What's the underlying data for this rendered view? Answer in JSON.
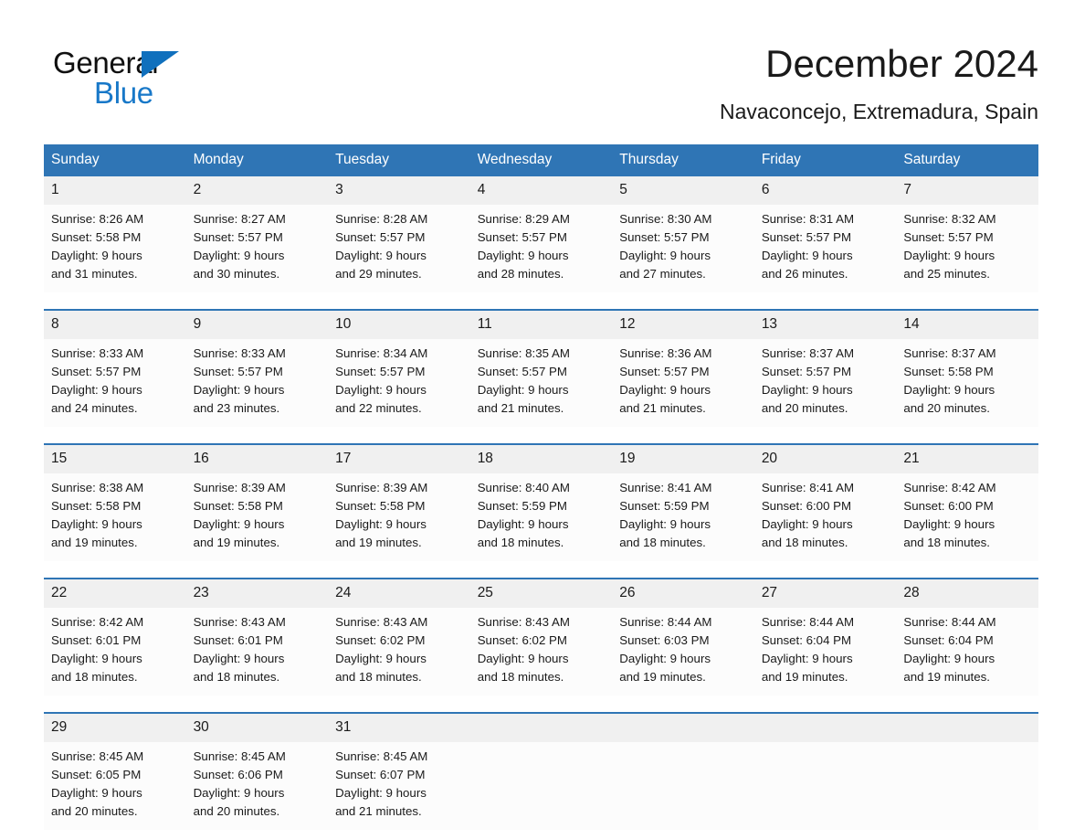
{
  "brand": {
    "name_part1": "General",
    "name_part2": "Blue"
  },
  "header": {
    "title": "December 2024",
    "subtitle": "Navaconcejo, Extremadura, Spain"
  },
  "colors": {
    "header_blue": "#2f75b5",
    "logo_blue": "#1878c8",
    "daynum_band": "#f0f0f0",
    "cell_bg": "#fcfcfc"
  },
  "calendar": {
    "weekday_headers": [
      "Sunday",
      "Monday",
      "Tuesday",
      "Wednesday",
      "Thursday",
      "Friday",
      "Saturday"
    ],
    "weeks": [
      [
        {
          "day": "1",
          "sunrise": "Sunrise: 8:26 AM",
          "sunset": "Sunset: 5:58 PM",
          "daylight1": "Daylight: 9 hours",
          "daylight2": "and 31 minutes."
        },
        {
          "day": "2",
          "sunrise": "Sunrise: 8:27 AM",
          "sunset": "Sunset: 5:57 PM",
          "daylight1": "Daylight: 9 hours",
          "daylight2": "and 30 minutes."
        },
        {
          "day": "3",
          "sunrise": "Sunrise: 8:28 AM",
          "sunset": "Sunset: 5:57 PM",
          "daylight1": "Daylight: 9 hours",
          "daylight2": "and 29 minutes."
        },
        {
          "day": "4",
          "sunrise": "Sunrise: 8:29 AM",
          "sunset": "Sunset: 5:57 PM",
          "daylight1": "Daylight: 9 hours",
          "daylight2": "and 28 minutes."
        },
        {
          "day": "5",
          "sunrise": "Sunrise: 8:30 AM",
          "sunset": "Sunset: 5:57 PM",
          "daylight1": "Daylight: 9 hours",
          "daylight2": "and 27 minutes."
        },
        {
          "day": "6",
          "sunrise": "Sunrise: 8:31 AM",
          "sunset": "Sunset: 5:57 PM",
          "daylight1": "Daylight: 9 hours",
          "daylight2": "and 26 minutes."
        },
        {
          "day": "7",
          "sunrise": "Sunrise: 8:32 AM",
          "sunset": "Sunset: 5:57 PM",
          "daylight1": "Daylight: 9 hours",
          "daylight2": "and 25 minutes."
        }
      ],
      [
        {
          "day": "8",
          "sunrise": "Sunrise: 8:33 AM",
          "sunset": "Sunset: 5:57 PM",
          "daylight1": "Daylight: 9 hours",
          "daylight2": "and 24 minutes."
        },
        {
          "day": "9",
          "sunrise": "Sunrise: 8:33 AM",
          "sunset": "Sunset: 5:57 PM",
          "daylight1": "Daylight: 9 hours",
          "daylight2": "and 23 minutes."
        },
        {
          "day": "10",
          "sunrise": "Sunrise: 8:34 AM",
          "sunset": "Sunset: 5:57 PM",
          "daylight1": "Daylight: 9 hours",
          "daylight2": "and 22 minutes."
        },
        {
          "day": "11",
          "sunrise": "Sunrise: 8:35 AM",
          "sunset": "Sunset: 5:57 PM",
          "daylight1": "Daylight: 9 hours",
          "daylight2": "and 21 minutes."
        },
        {
          "day": "12",
          "sunrise": "Sunrise: 8:36 AM",
          "sunset": "Sunset: 5:57 PM",
          "daylight1": "Daylight: 9 hours",
          "daylight2": "and 21 minutes."
        },
        {
          "day": "13",
          "sunrise": "Sunrise: 8:37 AM",
          "sunset": "Sunset: 5:57 PM",
          "daylight1": "Daylight: 9 hours",
          "daylight2": "and 20 minutes."
        },
        {
          "day": "14",
          "sunrise": "Sunrise: 8:37 AM",
          "sunset": "Sunset: 5:58 PM",
          "daylight1": "Daylight: 9 hours",
          "daylight2": "and 20 minutes."
        }
      ],
      [
        {
          "day": "15",
          "sunrise": "Sunrise: 8:38 AM",
          "sunset": "Sunset: 5:58 PM",
          "daylight1": "Daylight: 9 hours",
          "daylight2": "and 19 minutes."
        },
        {
          "day": "16",
          "sunrise": "Sunrise: 8:39 AM",
          "sunset": "Sunset: 5:58 PM",
          "daylight1": "Daylight: 9 hours",
          "daylight2": "and 19 minutes."
        },
        {
          "day": "17",
          "sunrise": "Sunrise: 8:39 AM",
          "sunset": "Sunset: 5:58 PM",
          "daylight1": "Daylight: 9 hours",
          "daylight2": "and 19 minutes."
        },
        {
          "day": "18",
          "sunrise": "Sunrise: 8:40 AM",
          "sunset": "Sunset: 5:59 PM",
          "daylight1": "Daylight: 9 hours",
          "daylight2": "and 18 minutes."
        },
        {
          "day": "19",
          "sunrise": "Sunrise: 8:41 AM",
          "sunset": "Sunset: 5:59 PM",
          "daylight1": "Daylight: 9 hours",
          "daylight2": "and 18 minutes."
        },
        {
          "day": "20",
          "sunrise": "Sunrise: 8:41 AM",
          "sunset": "Sunset: 6:00 PM",
          "daylight1": "Daylight: 9 hours",
          "daylight2": "and 18 minutes."
        },
        {
          "day": "21",
          "sunrise": "Sunrise: 8:42 AM",
          "sunset": "Sunset: 6:00 PM",
          "daylight1": "Daylight: 9 hours",
          "daylight2": "and 18 minutes."
        }
      ],
      [
        {
          "day": "22",
          "sunrise": "Sunrise: 8:42 AM",
          "sunset": "Sunset: 6:01 PM",
          "daylight1": "Daylight: 9 hours",
          "daylight2": "and 18 minutes."
        },
        {
          "day": "23",
          "sunrise": "Sunrise: 8:43 AM",
          "sunset": "Sunset: 6:01 PM",
          "daylight1": "Daylight: 9 hours",
          "daylight2": "and 18 minutes."
        },
        {
          "day": "24",
          "sunrise": "Sunrise: 8:43 AM",
          "sunset": "Sunset: 6:02 PM",
          "daylight1": "Daylight: 9 hours",
          "daylight2": "and 18 minutes."
        },
        {
          "day": "25",
          "sunrise": "Sunrise: 8:43 AM",
          "sunset": "Sunset: 6:02 PM",
          "daylight1": "Daylight: 9 hours",
          "daylight2": "and 18 minutes."
        },
        {
          "day": "26",
          "sunrise": "Sunrise: 8:44 AM",
          "sunset": "Sunset: 6:03 PM",
          "daylight1": "Daylight: 9 hours",
          "daylight2": "and 19 minutes."
        },
        {
          "day": "27",
          "sunrise": "Sunrise: 8:44 AM",
          "sunset": "Sunset: 6:04 PM",
          "daylight1": "Daylight: 9 hours",
          "daylight2": "and 19 minutes."
        },
        {
          "day": "28",
          "sunrise": "Sunrise: 8:44 AM",
          "sunset": "Sunset: 6:04 PM",
          "daylight1": "Daylight: 9 hours",
          "daylight2": "and 19 minutes."
        }
      ],
      [
        {
          "day": "29",
          "sunrise": "Sunrise: 8:45 AM",
          "sunset": "Sunset: 6:05 PM",
          "daylight1": "Daylight: 9 hours",
          "daylight2": "and 20 minutes."
        },
        {
          "day": "30",
          "sunrise": "Sunrise: 8:45 AM",
          "sunset": "Sunset: 6:06 PM",
          "daylight1": "Daylight: 9 hours",
          "daylight2": "and 20 minutes."
        },
        {
          "day": "31",
          "sunrise": "Sunrise: 8:45 AM",
          "sunset": "Sunset: 6:07 PM",
          "daylight1": "Daylight: 9 hours",
          "daylight2": "and 21 minutes."
        },
        {
          "day": "",
          "sunrise": "",
          "sunset": "",
          "daylight1": "",
          "daylight2": ""
        },
        {
          "day": "",
          "sunrise": "",
          "sunset": "",
          "daylight1": "",
          "daylight2": ""
        },
        {
          "day": "",
          "sunrise": "",
          "sunset": "",
          "daylight1": "",
          "daylight2": ""
        },
        {
          "day": "",
          "sunrise": "",
          "sunset": "",
          "daylight1": "",
          "daylight2": ""
        }
      ]
    ]
  }
}
